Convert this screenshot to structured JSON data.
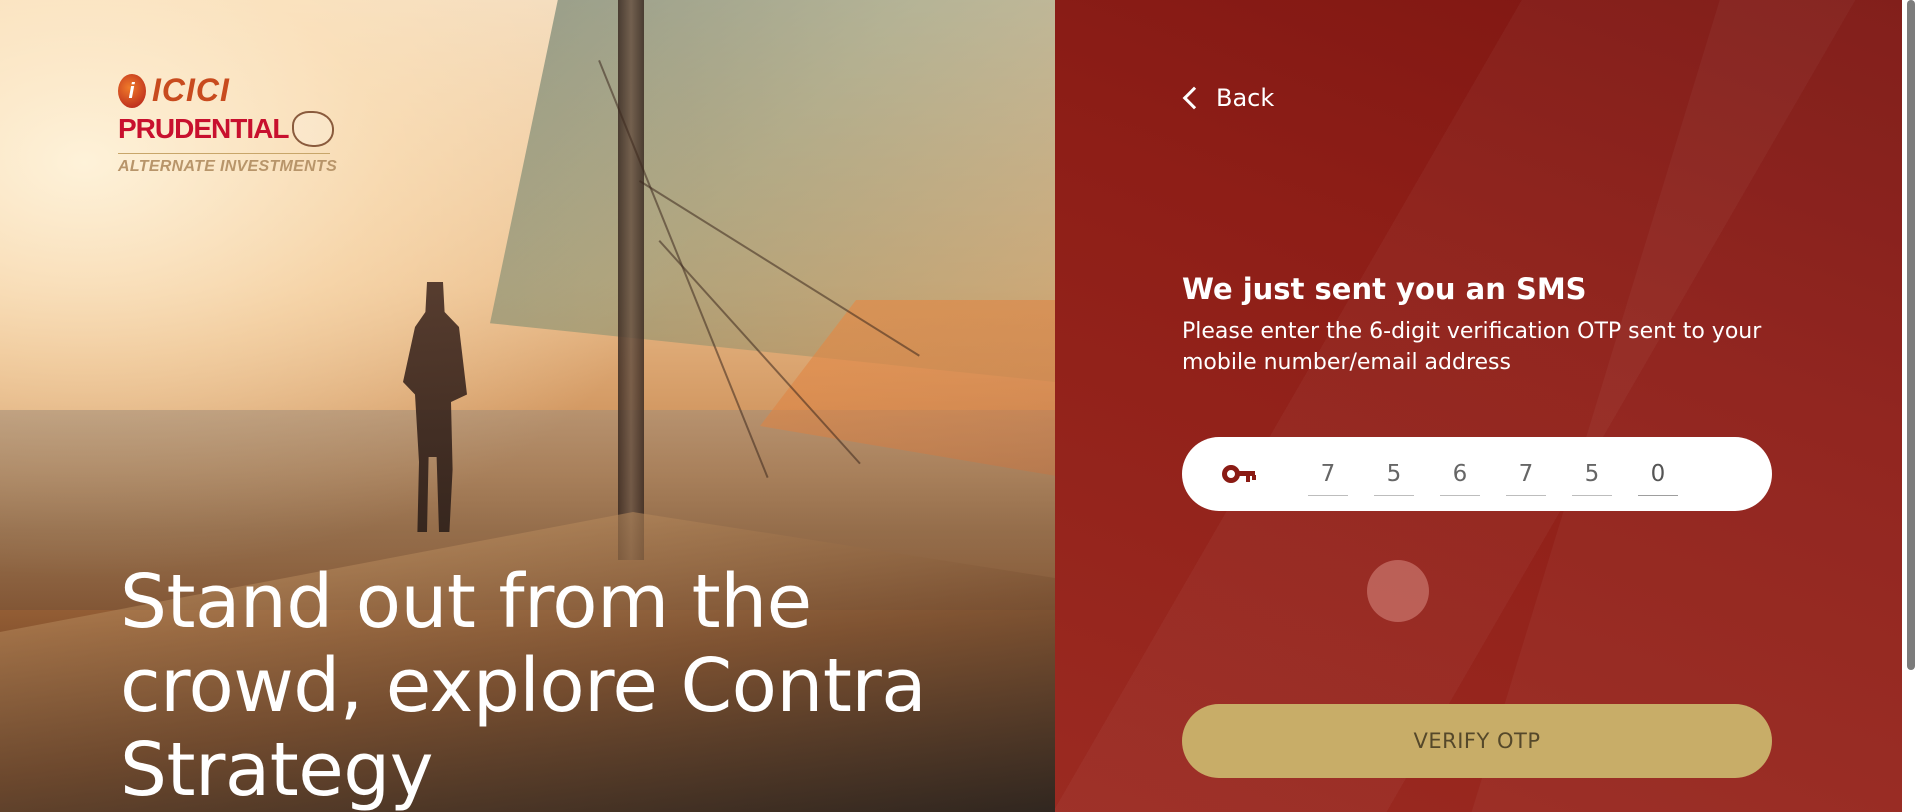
{
  "brand": {
    "top": "ICICI",
    "mid": "PRUDENTIAL",
    "sub": "ALTERNATE INVESTMENTS"
  },
  "hero": {
    "headline": "Stand out from the crowd, explore Contra Strategy"
  },
  "nav": {
    "back_label": "Back",
    "back_icon": "chevron-left-icon"
  },
  "otp_form": {
    "title": "We just sent you an SMS",
    "subtitle": "Please enter the 6-digit verification OTP sent to your mobile number/email address",
    "key_icon": "key-icon",
    "digits": [
      "7",
      "5",
      "6",
      "7",
      "5",
      "0"
    ],
    "verify_label": "VERIFY OTP"
  },
  "colors": {
    "panel": "#8e1e17",
    "accent_gold": "#c8ad68",
    "key_icon": "#8a1b14"
  }
}
